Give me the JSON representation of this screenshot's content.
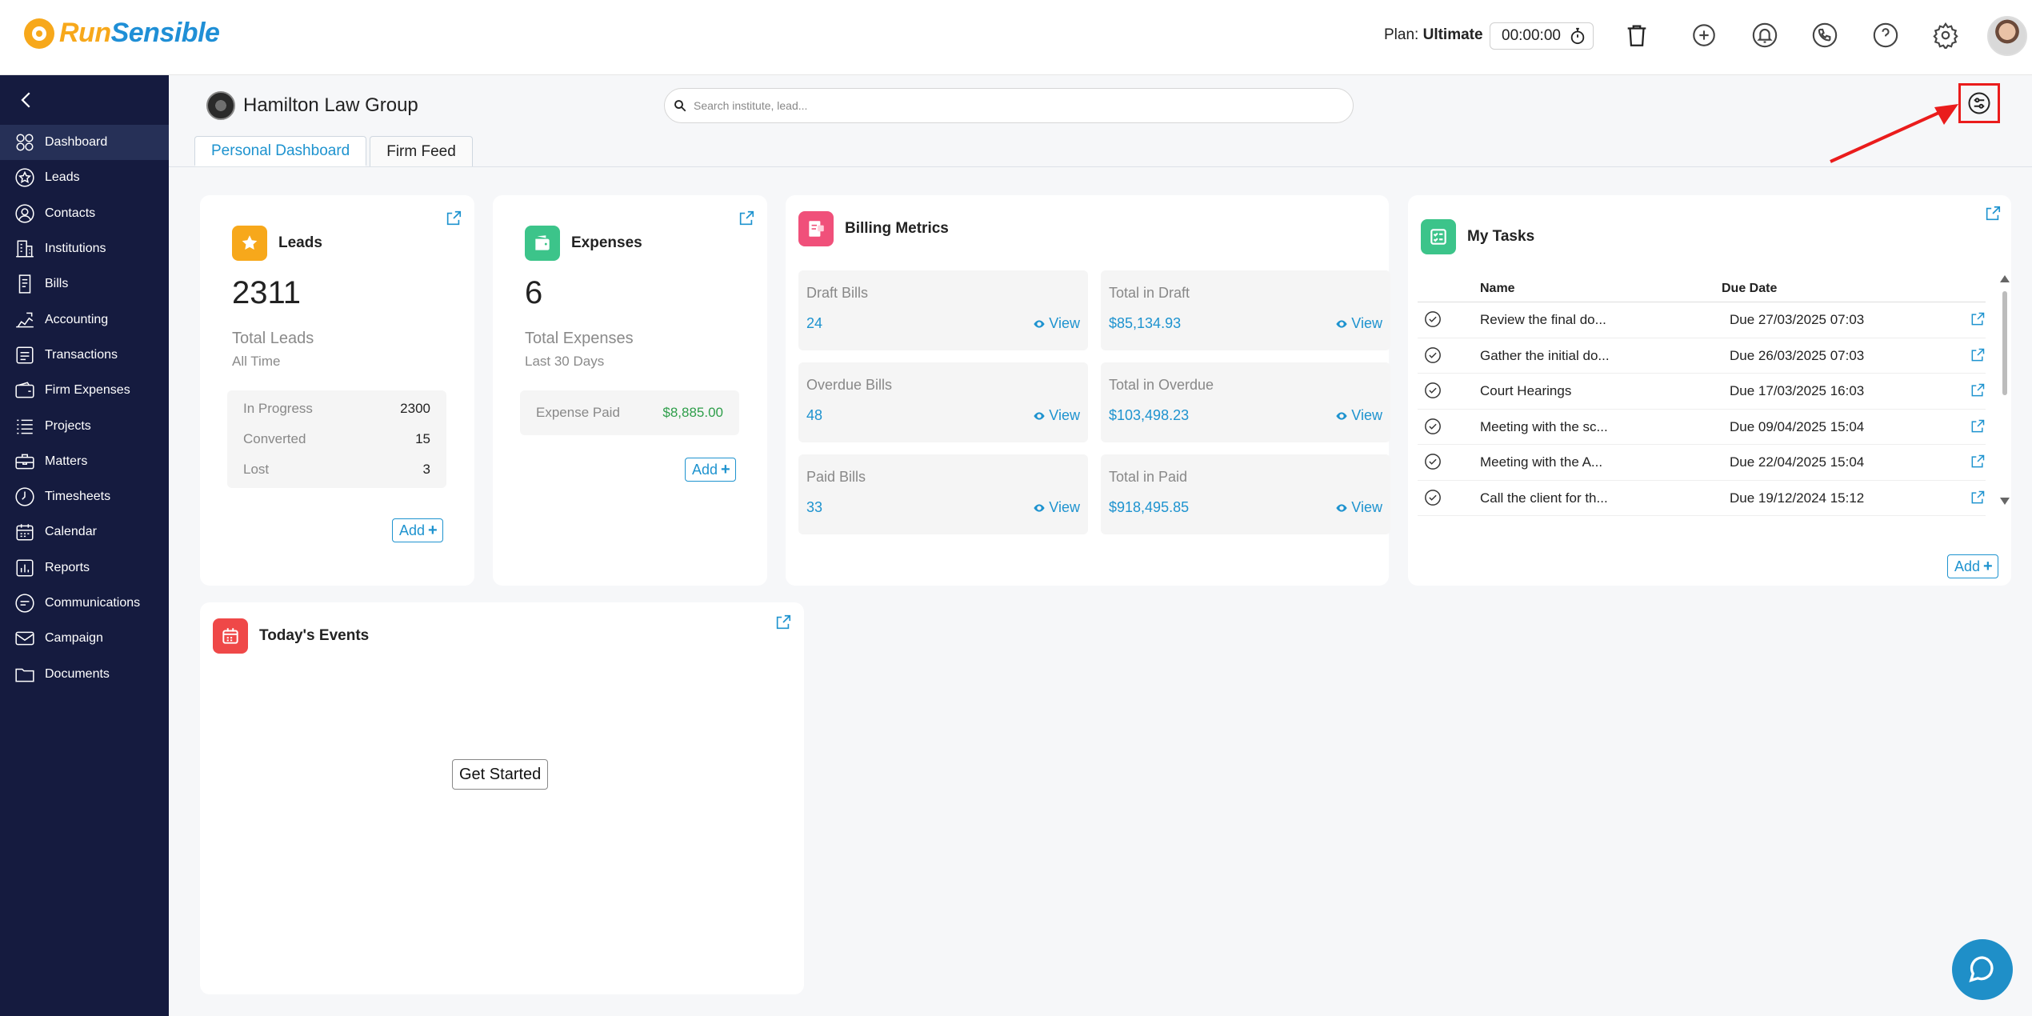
{
  "brand": {
    "part1": "Run",
    "part2": "Sensible"
  },
  "header": {
    "plan_label": "Plan:",
    "plan_value": "Ultimate",
    "timer": "00:00:00",
    "icons": [
      "trash-icon",
      "add-call-icon",
      "bell-icon",
      "phone-icon",
      "help-icon",
      "gear-icon"
    ]
  },
  "sidebar": {
    "items": [
      {
        "label": "Dashboard",
        "icon": "dashboard-icon"
      },
      {
        "label": "Leads",
        "icon": "star-icon"
      },
      {
        "label": "Contacts",
        "icon": "user-icon"
      },
      {
        "label": "Institutions",
        "icon": "building-icon"
      },
      {
        "label": "Bills",
        "icon": "bill-icon"
      },
      {
        "label": "Accounting",
        "icon": "chart-icon"
      },
      {
        "label": "Transactions",
        "icon": "transactions-icon"
      },
      {
        "label": "Firm Expenses",
        "icon": "wallet-icon"
      },
      {
        "label": "Projects",
        "icon": "list-icon"
      },
      {
        "label": "Matters",
        "icon": "briefcase-icon"
      },
      {
        "label": "Timesheets",
        "icon": "clock-icon"
      },
      {
        "label": "Calendar",
        "icon": "calendar-icon"
      },
      {
        "label": "Reports",
        "icon": "report-icon"
      },
      {
        "label": "Communications",
        "icon": "chat-icon"
      },
      {
        "label": "Campaign",
        "icon": "mail-icon"
      },
      {
        "label": "Documents",
        "icon": "folder-icon"
      }
    ]
  },
  "page": {
    "firm_name": "Hamilton Law Group",
    "search_placeholder": "Search institute, lead...",
    "tabs": [
      "Personal Dashboard",
      "Firm Feed"
    ]
  },
  "leads": {
    "title": "Leads",
    "total": "2311",
    "sub1": "Total Leads",
    "sub2": "All Time",
    "rows": [
      {
        "k": "In Progress",
        "v": "2300"
      },
      {
        "k": "Converted",
        "v": "15"
      },
      {
        "k": "Lost",
        "v": "3"
      }
    ],
    "add": "Add"
  },
  "expenses": {
    "title": "Expenses",
    "total": "6",
    "sub1": "Total Expenses",
    "sub2": "Last 30 Days",
    "paid_label": "Expense Paid",
    "paid_value": "$8,885.00",
    "add": "Add"
  },
  "billing": {
    "title": "Billing Metrics",
    "view": "View",
    "metrics": [
      {
        "label": "Draft Bills",
        "value": "24"
      },
      {
        "label": "Total in Draft",
        "value": "$85,134.93"
      },
      {
        "label": "Overdue Bills",
        "value": "48"
      },
      {
        "label": "Total in Overdue",
        "value": "$103,498.23"
      },
      {
        "label": "Paid Bills",
        "value": "33"
      },
      {
        "label": "Total in Paid",
        "value": "$918,495.85"
      }
    ]
  },
  "tasks": {
    "title": "My Tasks",
    "col_name": "Name",
    "col_due": "Due Date",
    "rows": [
      {
        "name": "Review the final do...",
        "due": "Due 27/03/2025 07:03"
      },
      {
        "name": "Gather the initial do...",
        "due": "Due 26/03/2025 07:03"
      },
      {
        "name": "Court Hearings",
        "due": "Due 17/03/2025 16:03"
      },
      {
        "name": "Meeting with the sc...",
        "due": "Due 09/04/2025 15:04"
      },
      {
        "name": "Meeting with the A...",
        "due": "Due 22/04/2025 15:04"
      },
      {
        "name": "Call the client for th...",
        "due": "Due 19/12/2024 15:12"
      }
    ],
    "add": "Add"
  },
  "events": {
    "title": "Today's Events",
    "cta": "Get Started"
  },
  "colors": {
    "sidebar_bg": "#151b3f",
    "accent": "#1e93cf",
    "brand_orange": "#f7a81b",
    "highlight_red": "#ea1c1c"
  }
}
